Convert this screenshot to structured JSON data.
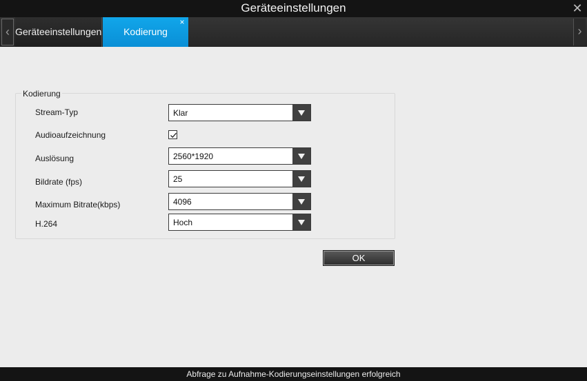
{
  "window": {
    "title": "Geräteeinstellungen",
    "close_icon": "close-icon"
  },
  "tabs": [
    {
      "label": "Geräteeinstellungen",
      "active": false
    },
    {
      "label": "Kodierung",
      "active": true,
      "close": "×"
    }
  ],
  "group": {
    "title": "Kodierung",
    "fields": {
      "stream_type": {
        "label": "Stream-Typ",
        "value": "Klar"
      },
      "audio": {
        "label": "Audioaufzeichnung",
        "checked": true
      },
      "resolution": {
        "label": "Auslösung",
        "value": "2560*1920"
      },
      "framerate": {
        "label": "Bildrate (fps)",
        "value": "25"
      },
      "max_bitrate": {
        "label": "Maximum Bitrate(kbps)",
        "value": "4096"
      },
      "h264": {
        "label": "H.264",
        "value": "Hoch"
      }
    }
  },
  "ok_label": "OK",
  "status": "Abfrage zu Aufnahme-Kodierungseinstellungen erfolgreich",
  "colors": {
    "active_tab": "#0a9ae0",
    "titlebar": "#141414",
    "background": "#ececec"
  }
}
